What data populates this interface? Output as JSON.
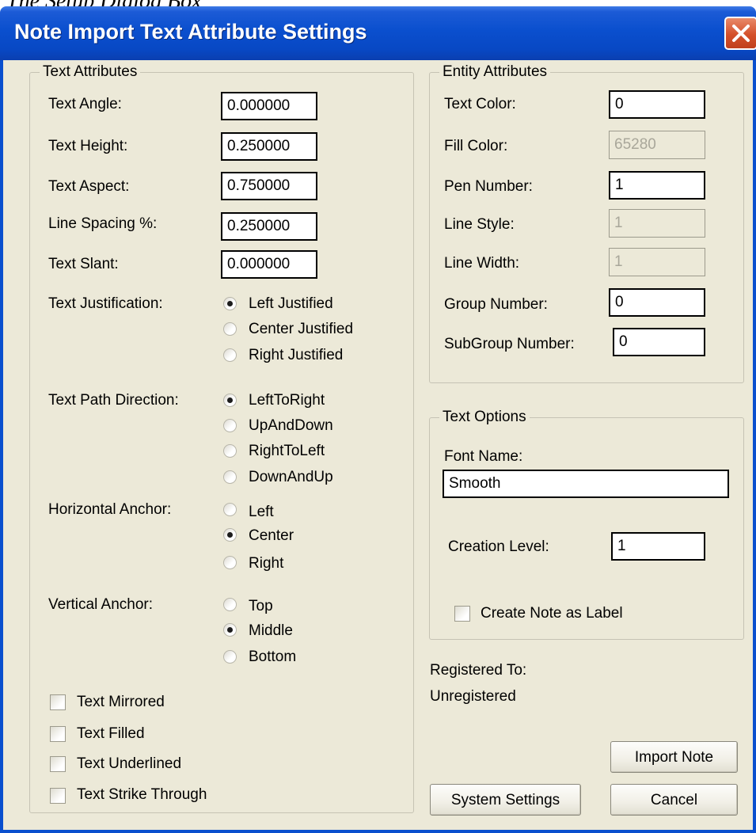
{
  "caption": "The Setup Dialog Box",
  "window": {
    "title": "Note Import Text Attribute Settings"
  },
  "text_attributes": {
    "legend": "Text Attributes",
    "fields": [
      {
        "label": "Text Angle:",
        "value": "0.000000"
      },
      {
        "label": "Text Height:",
        "value": "0.250000"
      },
      {
        "label": "Text Aspect:",
        "value": "0.750000"
      },
      {
        "label": "Line Spacing %:",
        "value": "0.250000"
      },
      {
        "label": "Text Slant:",
        "value": "0.000000"
      }
    ],
    "justification": {
      "label": "Text Justification:",
      "options": [
        "Left Justified",
        "Center Justified",
        "Right Justified"
      ],
      "selected": "Left Justified"
    },
    "path_direction": {
      "label": "Text Path Direction:",
      "options": [
        "LeftToRight",
        "UpAndDown",
        "RightToLeft",
        "DownAndUp"
      ],
      "selected": "LeftToRight"
    },
    "horizontal_anchor": {
      "label": "Horizontal Anchor:",
      "options": [
        "Left",
        "Center",
        "Right"
      ],
      "selected": "Center"
    },
    "vertical_anchor": {
      "label": "Vertical Anchor:",
      "options": [
        "Top",
        "Middle",
        "Bottom"
      ],
      "selected": "Middle"
    },
    "checkboxes": [
      {
        "label": "Text Mirrored",
        "checked": false
      },
      {
        "label": "Text Filled",
        "checked": false
      },
      {
        "label": "Text Underlined",
        "checked": false
      },
      {
        "label": "Text Strike Through",
        "checked": false
      }
    ]
  },
  "entity_attributes": {
    "legend": "Entity Attributes",
    "fields": [
      {
        "label": "Text Color:",
        "value": "0",
        "enabled": true
      },
      {
        "label": "Fill Color:",
        "value": "65280",
        "enabled": false
      },
      {
        "label": "Pen Number:",
        "value": "1",
        "enabled": true
      },
      {
        "label": "Line Style:",
        "value": "1",
        "enabled": false
      },
      {
        "label": "Line Width:",
        "value": "1",
        "enabled": false
      },
      {
        "label": "Group Number:",
        "value": "0",
        "enabled": true
      },
      {
        "label": "SubGroup Number:",
        "value": "0",
        "enabled": true
      }
    ]
  },
  "text_options": {
    "legend": "Text Options",
    "font_name_label": "Font Name:",
    "font_name_value": "Smooth",
    "creation_level_label": "Creation Level:",
    "creation_level_value": "1",
    "create_label_checkbox": {
      "label": "Create Note as Label",
      "checked": false
    }
  },
  "registration": {
    "label": "Registered To:",
    "value": "Unregistered"
  },
  "buttons": {
    "import_note": "Import Note",
    "system_settings": "System Settings",
    "cancel": "Cancel"
  },
  "colors": {
    "titlebar": "#0a4fce",
    "dialog_bg": "#ece9d8",
    "close_button": "#d4502a"
  }
}
